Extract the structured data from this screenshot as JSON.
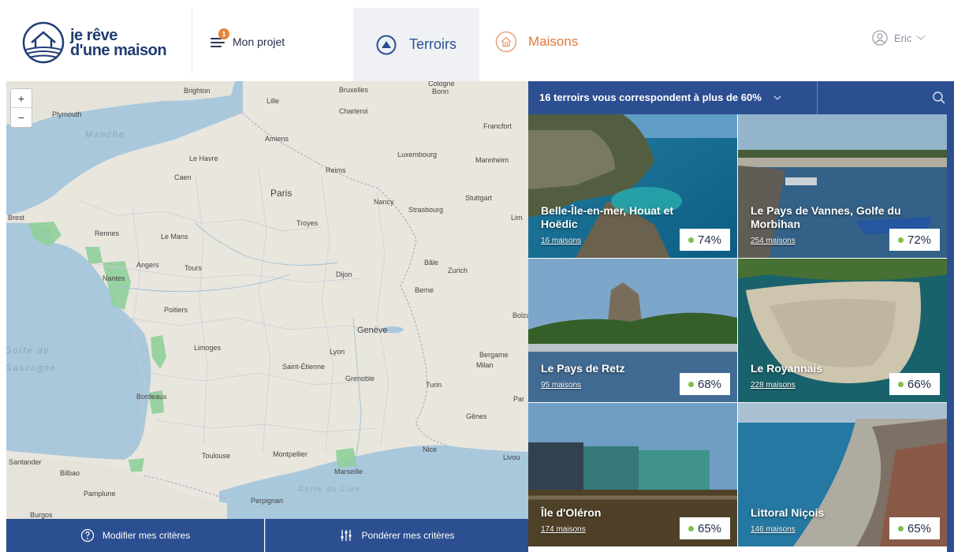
{
  "brand": {
    "line1": "je rêve",
    "line2": "d'une maison"
  },
  "nav": {
    "projet_label": "Mon projet",
    "projet_badge": "1",
    "terroirs_label": "Terroirs",
    "maisons_label": "Maisons",
    "user_name": "Eric"
  },
  "map": {
    "zoom_in": "+",
    "zoom_out": "−",
    "labels": [
      "Plymouth",
      "Manche",
      "Brighton",
      "Lille",
      "Bruxelles",
      "Cologne",
      "Bonn",
      "Charleroi",
      "Amiens",
      "Francfort",
      "Le Havre",
      "Luxembourg",
      "Mannheim",
      "Caen",
      "Reims",
      "Paris",
      "Nancy",
      "Stuttgart",
      "Strasbourg",
      "Brest",
      "Rennes",
      "Le Mans",
      "Troyes",
      "Lim",
      "Angers",
      "Tours",
      "Bâle",
      "Zurich",
      "Nantes",
      "Dijon",
      "Berne",
      "Poitiers",
      "Genève",
      "Bolza",
      "Golfe de",
      "Gascogne",
      "Limoges",
      "Lyon",
      "Bergame",
      "Milan",
      "Saint-Étienne",
      "Grenoble",
      "Turin",
      "Bordeaux",
      "Par",
      "Gênes",
      "Santander",
      "Toulouse",
      "Montpellier",
      "Nice",
      "Livou",
      "Bilbao",
      "Marseille",
      "Pamplune",
      "Perpignan",
      "Golfe du Lion",
      "Burgos"
    ]
  },
  "actions": {
    "modify_label": "Modifier mes critères",
    "weight_label": "Pondérer mes critères"
  },
  "results": {
    "title": "16 terroirs vous correspondent à plus de 60%",
    "cards": [
      {
        "name": "Belle-Île-en-mer, Houat et Hoëdic",
        "count": "16 maisons",
        "score": "74%"
      },
      {
        "name": "Le Pays de Vannes, Golfe du Morbihan",
        "count": "254 maisons",
        "score": "72%"
      },
      {
        "name": "Le Pays de Retz",
        "count": "95 maisons",
        "score": "68%"
      },
      {
        "name": "Le Royannais",
        "count": "228 maisons",
        "score": "66%"
      },
      {
        "name": "Île d'Oléron",
        "count": "174 maisons",
        "score": "65%"
      },
      {
        "name": "Littoral Niçois",
        "count": "146 maisons",
        "score": "65%"
      }
    ]
  },
  "colors": {
    "primary": "#2c4f91",
    "accent": "#e07b3a",
    "match_dot": "#7cc04b",
    "region_fill": "#8fcf9a"
  }
}
